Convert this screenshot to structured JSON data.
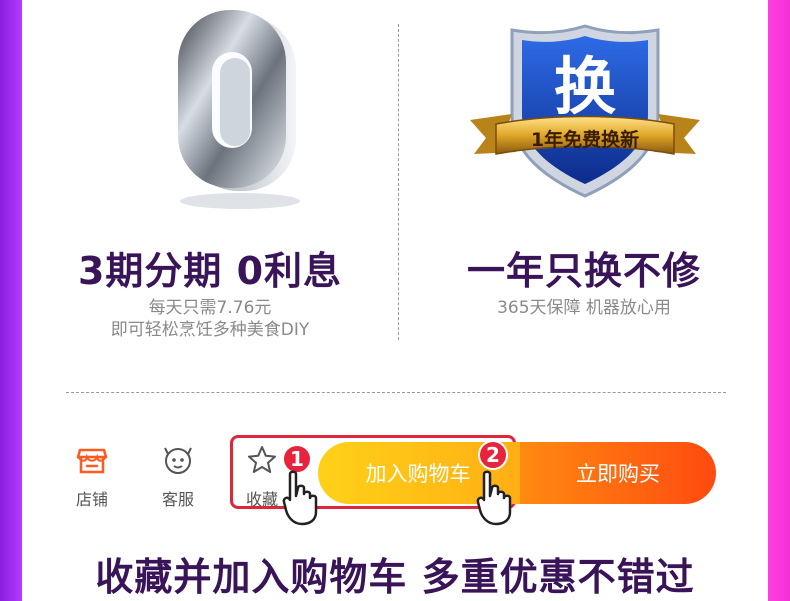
{
  "promo_left": {
    "hero_text": "0",
    "headline": "3期分期 0利息",
    "sub_line1": "每天只需7.76元",
    "sub_line2": "即可轻松烹饪多种美食DIY"
  },
  "promo_right": {
    "badge_char": "换",
    "ribbon_text": "1年免费换新",
    "headline": "一年只换不修",
    "sub_line1": "365天保障 机器放心用"
  },
  "actions": {
    "shop_label": "店铺",
    "service_label": "客服",
    "favorite_label": "收藏",
    "cart_label": "加入购物车",
    "buy_label": "立即购买",
    "step1": "1",
    "step2": "2"
  },
  "footer": {
    "title": "收藏并加入购物车 多重优惠不错过"
  },
  "colors": {
    "accent_red": "#e0263a",
    "cart_yellow": "#ffc116",
    "buy_orange": "#ff6a10",
    "headline_purple": "#3a1458"
  }
}
